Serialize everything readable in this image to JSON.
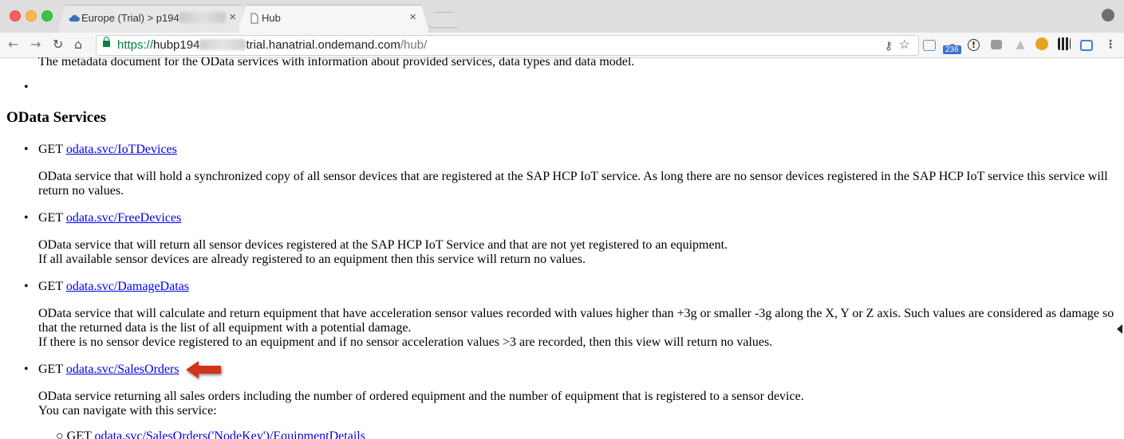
{
  "browser": {
    "tabs": [
      {
        "label": "Europe (Trial) > p194",
        "close": "×"
      },
      {
        "label": "Hub",
        "close": "×"
      }
    ],
    "url": {
      "scheme": "https://",
      "host_prefix": "hubp194",
      "host_suffix": "trial.hanatrial.ondemand.com",
      "path": "/hub/"
    },
    "nav": {
      "back": "←",
      "forward": "→",
      "reload": "↻",
      "home": "⌂"
    },
    "extension_badge": "236"
  },
  "page": {
    "clipped_text": "The metadata document for the OData services with information about provided services, data types and data model.",
    "section_title": "OData Services",
    "services": [
      {
        "method": "GET",
        "link": "odata.svc/IoTDevices",
        "description": [
          "OData service that will hold a synchronized copy of all sensor devices that are registered at the SAP HCP IoT service. As long there are no sensor devices registered in the SAP HCP IoT service this service will return no values."
        ]
      },
      {
        "method": "GET",
        "link": "odata.svc/FreeDevices",
        "description": [
          "OData service that will return all sensor devices registered at the SAP HCP IoT Service and that are not yet registered to an equipment.",
          "If all available sensor devices are already registered to an equipment then this service will return no values."
        ]
      },
      {
        "method": "GET",
        "link": "odata.svc/DamageDatas",
        "description": [
          "OData service that will calculate and return equipment that have acceleration sensor values recorded with values higher than +3g or smaller -3g along the X, Y or Z axis. Such values are considered as damage so that the returned data is the list of all equipment with a potential damage.",
          "If there is no sensor device registered to an equipment and if no sensor acceleration values >3 are recorded, then this view will return no values."
        ]
      },
      {
        "method": "GET",
        "link": "odata.svc/SalesOrders",
        "description": [
          "OData service returning all sales orders including the number of ordered equipment and the number of equipment that is registered to a sensor device.",
          "You can navigate with this service:"
        ]
      }
    ],
    "sub_item": {
      "method": "GET",
      "link": "odata.svc/SalesOrders('NodeKey')/EquipmentDetails"
    }
  },
  "colors": {
    "link": "#0000ee",
    "arrow": "#d0341f",
    "secure": "#0b8043"
  }
}
